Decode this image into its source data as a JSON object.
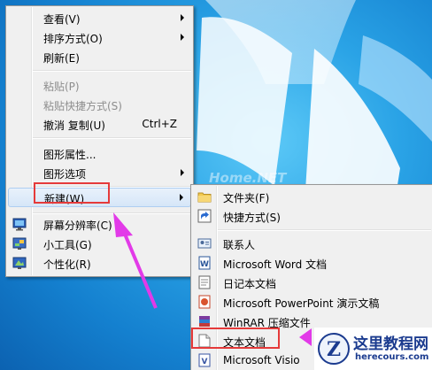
{
  "watermark": "Home.NET",
  "context_menu": {
    "items": [
      {
        "label": "查看(V)",
        "submenu": true
      },
      {
        "label": "排序方式(O)",
        "submenu": true
      },
      {
        "label": "刷新(E)"
      },
      {
        "label": "粘贴(P)",
        "disabled": true
      },
      {
        "label": "粘贴快捷方式(S)",
        "disabled": true
      },
      {
        "label": "撤消 复制(U)",
        "shortcut": "Ctrl+Z"
      },
      {
        "label": "图形属性..."
      },
      {
        "label": "图形选项",
        "submenu": true
      },
      {
        "label": "新建(W)",
        "submenu": true,
        "highlighted": true
      },
      {
        "label": "屏幕分辨率(C)",
        "icon": "display-settings-icon"
      },
      {
        "label": "小工具(G)",
        "icon": "gadgets-icon"
      },
      {
        "label": "个性化(R)",
        "icon": "personalize-icon"
      }
    ]
  },
  "new_submenu": {
    "items": [
      {
        "label": "文件夹(F)",
        "icon": "folder-icon"
      },
      {
        "label": "快捷方式(S)",
        "icon": "shortcut-icon"
      },
      {
        "label": "联系人",
        "icon": "contact-icon"
      },
      {
        "label": "Microsoft Word 文档",
        "icon": "word-icon"
      },
      {
        "label": "日记本文档",
        "icon": "journal-icon"
      },
      {
        "label": "Microsoft PowerPoint 演示文稿",
        "icon": "powerpoint-icon"
      },
      {
        "label": "WinRAR 压缩文件",
        "icon": "winrar-icon"
      },
      {
        "label": "文本文档",
        "icon": "text-document-icon"
      },
      {
        "label": "Microsoft Visio",
        "icon": "visio-icon"
      }
    ]
  },
  "logo": {
    "title": "这里教程网",
    "url": "herecours.com"
  },
  "colors": {
    "annotation_red": "#e53a3a",
    "annotation_arrow": "#e23ae8",
    "logo_blue": "#1b3b8f"
  }
}
